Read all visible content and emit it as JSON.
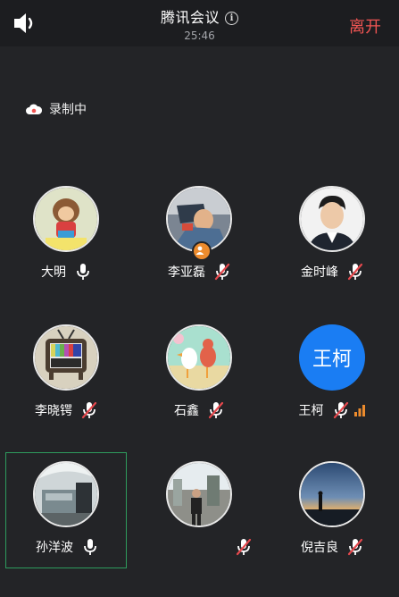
{
  "app": {
    "title": "腾讯会议",
    "timer": "25:46",
    "leave_label": "离开",
    "recording_label": "录制中",
    "info_icon": "ⓘ"
  },
  "participants": [
    {
      "name": "大明",
      "avatar_text": "",
      "mic": "on"
    },
    {
      "name": "李亚磊",
      "avatar_text": "",
      "mic": "muted"
    },
    {
      "name": "金时峰",
      "avatar_text": "",
      "mic": "muted"
    },
    {
      "name": "李晓锷",
      "avatar_text": "",
      "mic": "muted"
    },
    {
      "name": "石鑫",
      "avatar_text": "",
      "mic": "muted"
    },
    {
      "name": "王柯",
      "avatar_text": "王柯",
      "mic": "muted"
    },
    {
      "name": "孙洋波",
      "avatar_text": "",
      "mic": "on"
    },
    {
      "name": "",
      "avatar_text": "",
      "mic": "muted"
    },
    {
      "name": "倪吉良",
      "avatar_text": "",
      "mic": "muted"
    }
  ],
  "colors": {
    "accent": "#f15553",
    "active_border": "#2e9b5d",
    "text_avatar": "#1a7df3",
    "mute_red": "#e5484d",
    "signal": "#ec8b2d"
  }
}
